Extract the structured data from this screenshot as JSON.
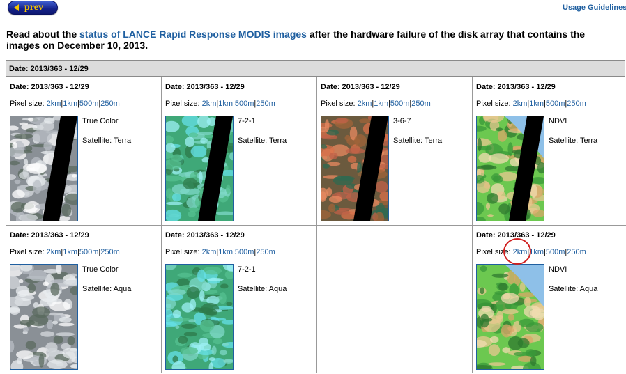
{
  "nav": {
    "prev_label": "prev",
    "usage_link": "Usage Guidelines"
  },
  "notice": {
    "pre": "Read about the ",
    "link": "status of LANCE Rapid Response MODIS images",
    "post": " after the hardware failure of the disk array that contains the images on December 10, 2013."
  },
  "table_header": "Date: 2013/363 - 12/29",
  "pixel_label": "Pixel size:",
  "sizes": [
    "2km",
    "1km",
    "500m",
    "250m"
  ],
  "sep": "|",
  "cells": [
    {
      "date": "Date: 2013/363 - 12/29",
      "band": "True Color",
      "satellite": "Satellite: Terra",
      "style": "truecolor"
    },
    {
      "date": "Date: 2013/363 - 12/29",
      "band": "7-2-1",
      "satellite": "Satellite: Terra",
      "style": "b721"
    },
    {
      "date": "Date: 2013/363 - 12/29",
      "band": "3-6-7",
      "satellite": "Satellite: Terra",
      "style": "b367"
    },
    {
      "date": "Date: 2013/363 - 12/29",
      "band": "NDVI",
      "satellite": "Satellite: Terra",
      "style": "ndvi"
    },
    {
      "date": "Date: 2013/363 - 12/29",
      "band": "True Color",
      "satellite": "Satellite: Aqua",
      "style": "truecolor"
    },
    {
      "date": "Date: 2013/363 - 12/29",
      "band": "7-2-1",
      "satellite": "Satellite: Aqua",
      "style": "b721"
    },
    null,
    {
      "date": "Date: 2013/363 - 12/29",
      "band": "NDVI",
      "satellite": "Satellite: Aqua",
      "style": "ndvi"
    }
  ],
  "colors": {
    "link": "#1f5fa0",
    "highlight_circle": "#d02020",
    "prev_text": "#f5c400"
  }
}
